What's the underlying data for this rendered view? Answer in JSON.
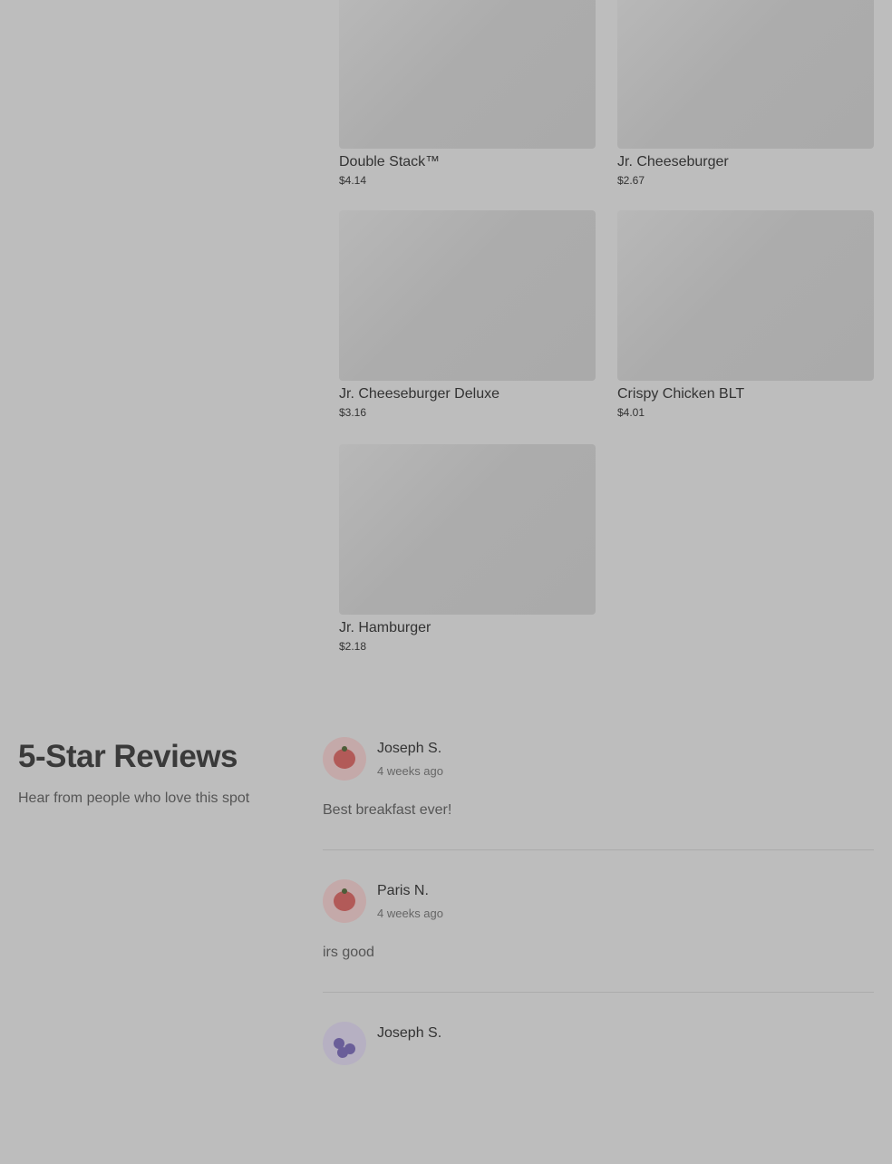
{
  "menu": {
    "items": [
      {
        "name": "Double Stack™",
        "price": "$4.14"
      },
      {
        "name": "Jr. Cheeseburger",
        "price": "$2.67"
      },
      {
        "name": "Jr. Cheeseburger Deluxe",
        "price": "$3.16"
      },
      {
        "name": "Crispy Chicken BLT",
        "price": "$4.01"
      },
      {
        "name": "Jr. Hamburger",
        "price": "$2.18"
      }
    ]
  },
  "reviews_section": {
    "title": "5-Star Reviews",
    "subtitle": "Hear from people who love this spot"
  },
  "reviews": [
    {
      "name": "Joseph S.",
      "time": "4 weeks ago",
      "text": "Best breakfast ever!",
      "avatar": "tomato-icon"
    },
    {
      "name": "Paris N.",
      "time": "4 weeks ago",
      "text": "irs good",
      "avatar": "tomato-icon"
    },
    {
      "name": "Joseph S.",
      "avatar": "blueberry-icon"
    }
  ]
}
